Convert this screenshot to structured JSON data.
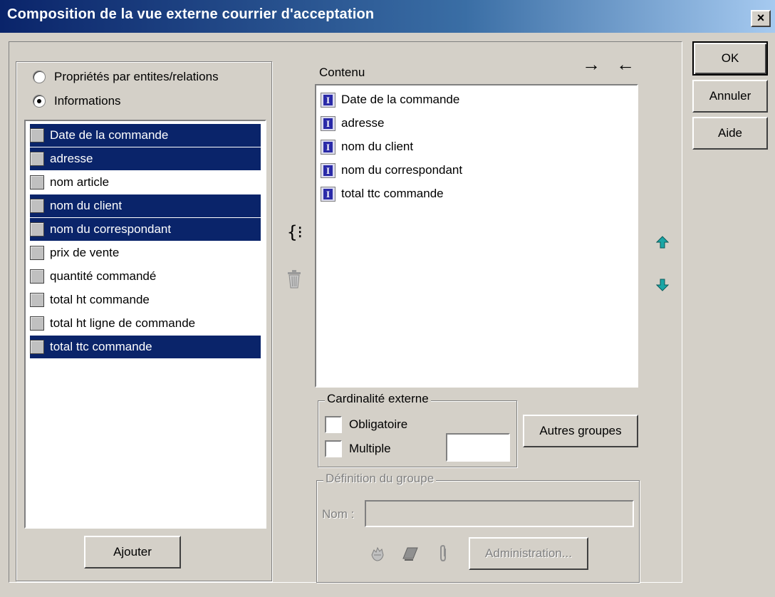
{
  "window": {
    "title": "Composition de la vue externe courrier d'acceptation",
    "close_symbol": "×"
  },
  "buttons": {
    "ok": "OK",
    "cancel": "Annuler",
    "help": "Aide",
    "add": "Ajouter",
    "other_groups": "Autres groupes",
    "administration": "Administration..."
  },
  "source": {
    "radios": [
      {
        "label": "Propriétés par entites/relations",
        "selected": false
      },
      {
        "label": "Informations",
        "selected": true
      }
    ],
    "items": [
      {
        "label": "Date de la commande",
        "selected": true
      },
      {
        "label": "adresse",
        "selected": true
      },
      {
        "label": "nom article",
        "selected": false
      },
      {
        "label": "nom du client",
        "selected": true
      },
      {
        "label": "nom du correspondant",
        "selected": true
      },
      {
        "label": "prix de vente",
        "selected": false
      },
      {
        "label": "quantité commandé",
        "selected": false
      },
      {
        "label": "total ht commande",
        "selected": false
      },
      {
        "label": "total ht ligne de commande",
        "selected": false
      },
      {
        "label": "total ttc commande",
        "selected": true
      }
    ]
  },
  "content": {
    "label": "Contenu",
    "item_icon": "information-icon",
    "items": [
      "Date de la commande",
      "adresse",
      "nom du client",
      "nom du correspondant",
      "total ttc commande"
    ]
  },
  "cardinality": {
    "label": "Cardinalité externe",
    "mandatory_label": "Obligatoire",
    "mandatory_checked": false,
    "multiple_label": "Multiple",
    "multiple_checked": false,
    "count_value": ""
  },
  "group_definition": {
    "label": "Définition du groupe",
    "name_label": "Nom :",
    "name_value": ""
  },
  "icons": {
    "arrow_right": "→",
    "arrow_left": "←",
    "group_braces": "{⁝",
    "trash": "trash-icon",
    "move_up": "up-arrow-icon",
    "move_down": "down-arrow-icon"
  },
  "colors": {
    "selection": "#0a246a",
    "dialog_bg": "#d4d0c8",
    "arrow_teal": "#1aa6a6"
  }
}
